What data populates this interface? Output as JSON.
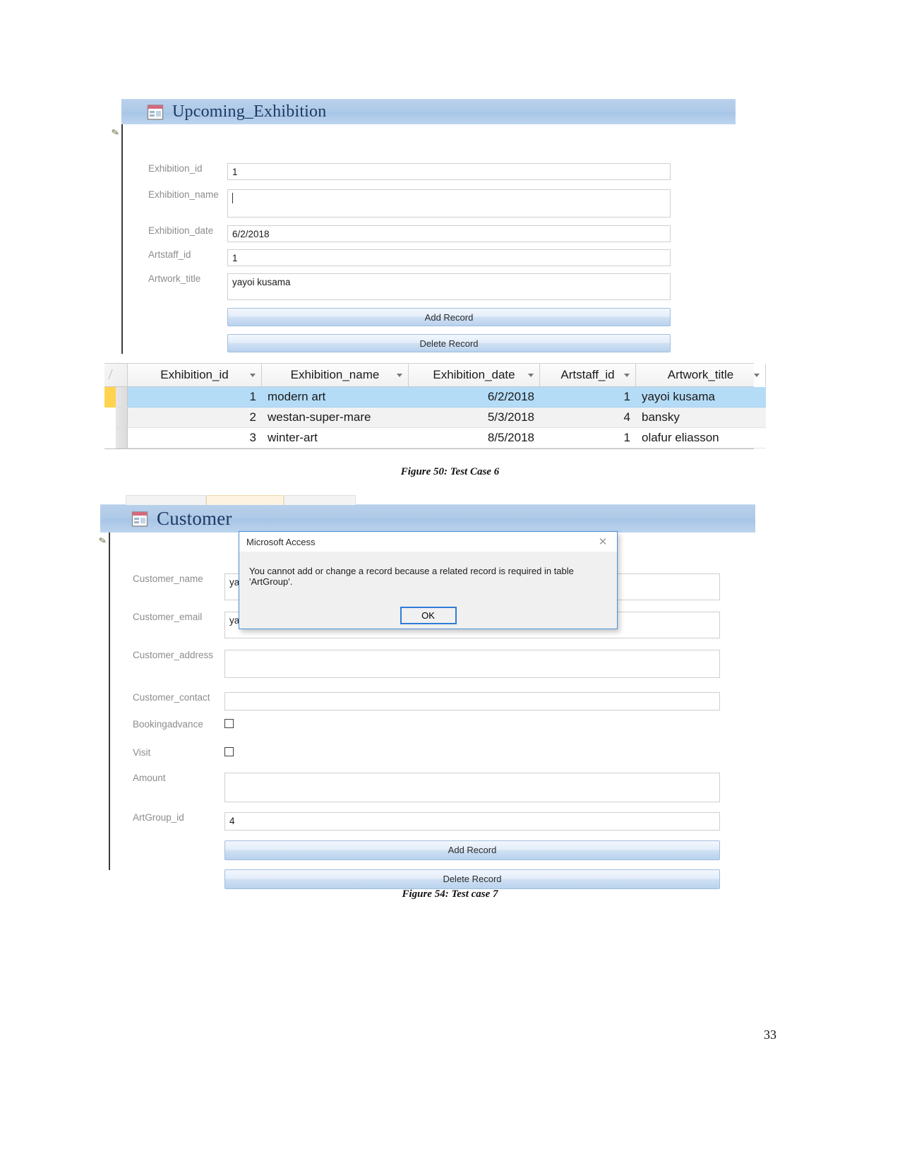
{
  "page": {
    "number": "33"
  },
  "figure1": {
    "caption": "Figure 50: Test Case 6",
    "form": {
      "title": "Upcoming_Exhibition",
      "icon": "form-view-icon",
      "fields": [
        {
          "label": "Exhibition_id",
          "value": "1"
        },
        {
          "label": "Exhibition_name",
          "value": ""
        },
        {
          "label": "Exhibition_date",
          "value": "6/2/2018"
        },
        {
          "label": "Artstaff_id",
          "value": "1"
        },
        {
          "label": "Artwork_title",
          "value": "yayoi kusama"
        }
      ],
      "buttons": {
        "add": "Add Record",
        "delete": "Delete Record"
      }
    },
    "datasheet": {
      "columns": [
        "Exhibition_id",
        "Exhibition_name",
        "Exhibition_date",
        "Artstaff_id",
        "Artwork_title"
      ],
      "rows": [
        {
          "selected": true,
          "cells": [
            "1",
            "modern art",
            "6/2/2018",
            "1",
            "yayoi kusama"
          ]
        },
        {
          "selected": false,
          "cells": [
            "2",
            "westan-super-mare",
            "5/3/2018",
            "4",
            "bansky"
          ]
        },
        {
          "selected": false,
          "cells": [
            "3",
            "winter-art",
            "8/5/2018",
            "1",
            "olafur eliasson"
          ]
        }
      ]
    }
  },
  "figure2": {
    "caption": "Figure 54: Test case 7",
    "form": {
      "title": "Customer",
      "icon": "form-view-icon",
      "fields": [
        {
          "label": "Customer_name",
          "value": "ya",
          "type": "text"
        },
        {
          "label": "Customer_email",
          "value": "ya",
          "type": "text"
        },
        {
          "label": "Customer_address",
          "value": "",
          "type": "text"
        },
        {
          "label": "Customer_contact",
          "value": "",
          "type": "text"
        },
        {
          "label": "Bookingadvance",
          "value": "",
          "type": "checkbox",
          "checked": false
        },
        {
          "label": "Visit",
          "value": "",
          "type": "checkbox",
          "checked": false
        },
        {
          "label": "Amount",
          "value": "",
          "type": "text"
        },
        {
          "label": "ArtGroup_id",
          "value": "4",
          "type": "text"
        }
      ],
      "buttons": {
        "add": "Add Record",
        "delete": "Delete Record"
      }
    },
    "dialog": {
      "title": "Microsoft Access",
      "message": "You cannot add or change a record because a related record is required in table 'ArtGroup'.",
      "ok_label": "OK",
      "close_icon": "close-icon",
      "accent": "#2d7cd6"
    }
  }
}
